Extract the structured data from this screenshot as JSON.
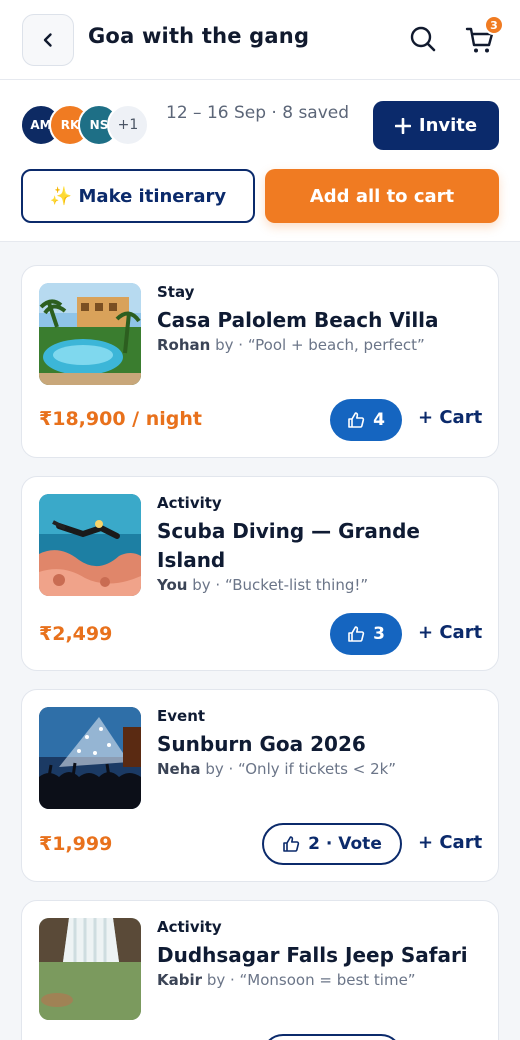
{
  "header": {
    "title": "Goa with the gang",
    "cart_count": "3"
  },
  "group": {
    "avatars": [
      "AM",
      "RK",
      "NS",
      "+1"
    ],
    "trip_info": "12 – 16 Sep · 8 saved",
    "invite_label": "Invite",
    "itinerary_label": "✨ Make itinerary",
    "add_all_label": "Add all to cart"
  },
  "items": [
    {
      "category": "Stay",
      "name": "Casa Palolem Beach Villa",
      "by_name": "Rohan",
      "by_text": "by · “Pool + beach, perfect”",
      "price": "₹18,900 / night",
      "votes": "4",
      "cart_label": "+ Cart"
    },
    {
      "category": "Activity",
      "name": "Scuba Diving — Grande Island",
      "by_name": "You",
      "by_text": "by · “Bucket-list thing!”",
      "price": "₹2,499",
      "votes": "3",
      "cart_label": "+ Cart"
    },
    {
      "category": "Event",
      "name": "Sunburn Goa 2026",
      "by_name": "Neha",
      "by_text": "by · “Only if tickets < 2k”",
      "price": "₹1,999",
      "votes": "2 · Vote",
      "cart_label": "+ Cart"
    },
    {
      "category": "Activity",
      "name": "Dudhsagar Falls Jeep Safari",
      "by_name": "Kabir",
      "by_text": "by · “Monsoon = best time”"
    }
  ],
  "colors": {
    "navy": "#0b2a6b",
    "accent_orange": "#f07b22",
    "vote_blue": "#1565c0"
  }
}
